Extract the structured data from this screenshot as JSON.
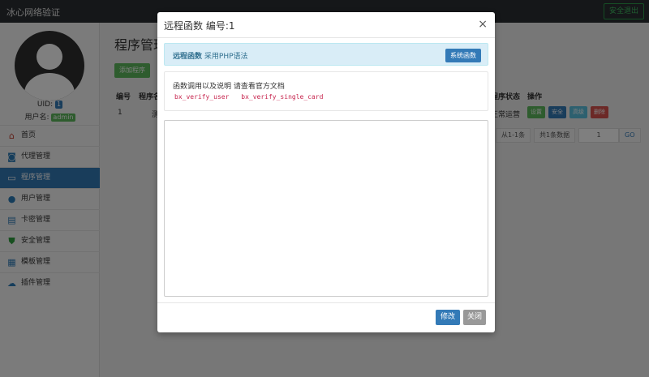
{
  "navbar": {
    "brand": "冰心网络验证",
    "logout_label": "安全退出"
  },
  "sidebar": {
    "uid_label": "UID:",
    "uid_value": "1",
    "username_label": "用户名:",
    "username_value": "admin",
    "items": [
      {
        "label": "首页",
        "icon": "home-icon"
      },
      {
        "label": "代理管理",
        "icon": "agent-icon"
      },
      {
        "label": "程序管理",
        "icon": "program-icon",
        "active": true
      },
      {
        "label": "用户管理",
        "icon": "user-icon"
      },
      {
        "label": "卡密管理",
        "icon": "card-icon"
      },
      {
        "label": "安全管理",
        "icon": "shield-icon"
      },
      {
        "label": "模板管理",
        "icon": "template-icon"
      },
      {
        "label": "插件管理",
        "icon": "plugin-icon"
      }
    ]
  },
  "main": {
    "title": "程序管理",
    "add_button": "添加程序",
    "table": {
      "headers": {
        "id": "编号",
        "program": "程序名",
        "status": "程序状态",
        "actions": "操作"
      },
      "row": {
        "id": "1",
        "name_fragment": "测",
        "status": "正常运营"
      },
      "row_actions": [
        "设置",
        "安全",
        "高级",
        "删除"
      ]
    },
    "pagination": {
      "range": "从1-1条",
      "total": "共1条数据",
      "page": "1",
      "go": "GO"
    }
  },
  "modal": {
    "title": "远程函数 编号:1",
    "close_glyph": "×",
    "info_bold": "远程函数",
    "info_text": "采用PHP语法",
    "system_functions_button": "系统函数",
    "doc_text": "函数调用以及说明 请查看官方文档",
    "functions": [
      "bx_verify_user",
      "bx_verify_single_card"
    ],
    "code_value": "",
    "edit_button": "修改",
    "close_button": "关闭"
  },
  "colors": {
    "primary": "#337ab7",
    "success": "#5cb85c",
    "info": "#5bc0de",
    "danger": "#d9534f",
    "navbar": "#2b2f33"
  }
}
